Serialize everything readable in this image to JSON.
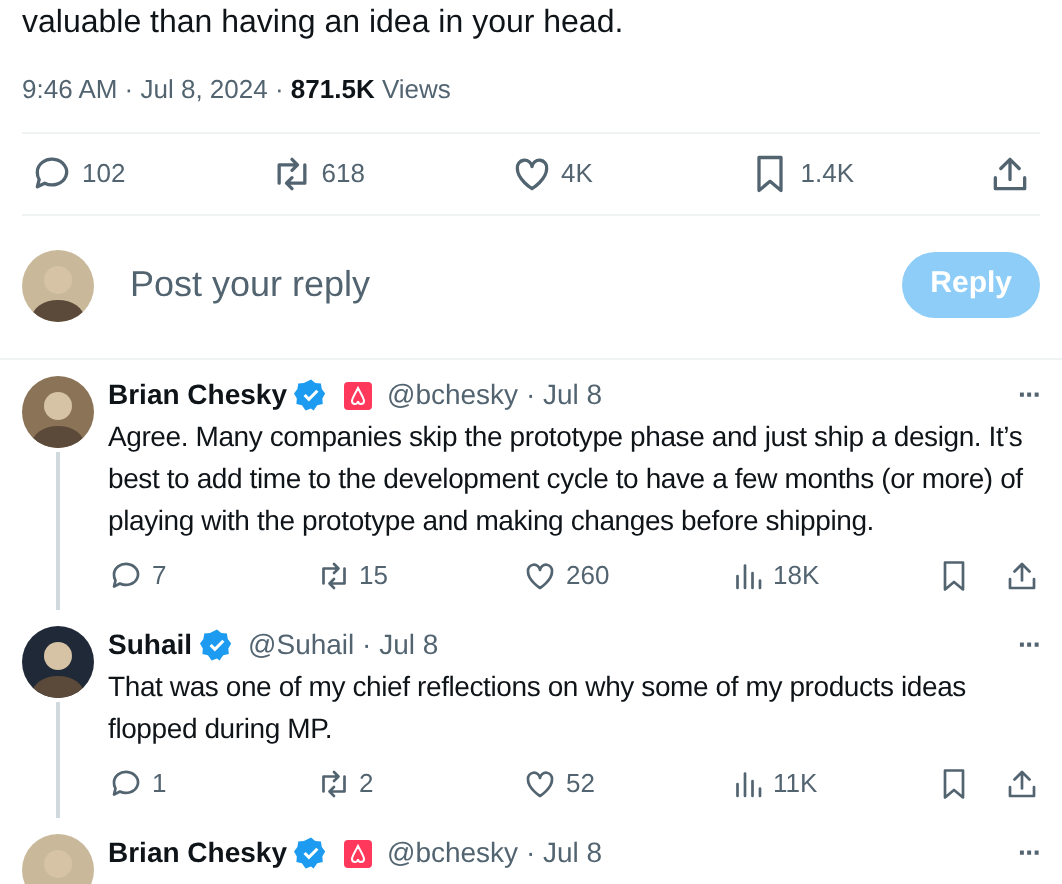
{
  "tweet": {
    "text_end": "valuable than having an idea in your head.",
    "meta": "9:46 AM · Jul 8, 2024 · **871.5K** Views",
    "actions": [
      {
        "kind": "reply",
        "count": "102"
      },
      {
        "kind": "repost",
        "count": "618"
      },
      {
        "kind": "like",
        "count": "4K"
      },
      {
        "kind": "bookmark",
        "count": "1.4K"
      },
      {
        "kind": "share"
      }
    ]
  },
  "composer": {
    "placeholder": "Post your reply",
    "button": {
      "label": "Reply",
      "disabled": true
    }
  },
  "replies": [
    {
      "name": "Brian Chesky",
      "verified": true,
      "affiliate": true,
      "handle_date": "@bchesky · Jul 8",
      "more": "···",
      "text": "Agree. Many companies skip the prototype phase and just ship a design. It’s best to add time to the development cycle to have a few months (or more) of playing with the prototype and making changes before shipping.",
      "thread_line": true,
      "actions": [
        {
          "kind": "reply",
          "count": "7"
        },
        {
          "kind": "repost",
          "count": "15"
        },
        {
          "kind": "like",
          "count": "260"
        },
        {
          "kind": "views",
          "count": "18K"
        },
        {
          "kind": "bookmark"
        },
        {
          "kind": "share"
        }
      ]
    },
    {
      "name": "Suhail",
      "verified": true,
      "affiliate": false,
      "handle_date": "@Suhail · Jul 8",
      "more": "···",
      "text": "That was one of my chief reflections on why some of my  products ideas flopped during MP.",
      "thread_line": true,
      "actions": [
        {
          "kind": "reply",
          "count": "1"
        },
        {
          "kind": "repost",
          "count": "2"
        },
        {
          "kind": "like",
          "count": "52"
        },
        {
          "kind": "views",
          "count": "11K"
        },
        {
          "kind": "bookmark"
        },
        {
          "kind": "share"
        }
      ]
    },
    {
      "name": "Brian Chesky",
      "verified": true,
      "affiliate": true,
      "handle_date": "@bchesky · Jul 8",
      "more": "···",
      "thread_line": false
    }
  ]
}
